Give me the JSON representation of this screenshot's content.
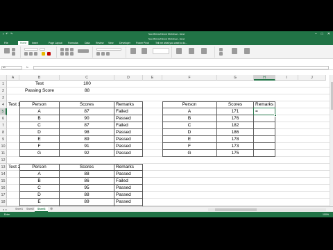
{
  "window": {
    "title_back": "New Microsoft Excel Worksheet - Excel",
    "title_front": "New Microsoft Excel Worksheet - Excel",
    "minimize": "–",
    "maximize": "□",
    "close": "✕"
  },
  "ribbon_tabs": [
    "File",
    "Home",
    "Insert",
    "Page Layout",
    "Formulas",
    "Data",
    "Review",
    "View",
    "Developer",
    "Power Pivot",
    "Tell me what you want to do..."
  ],
  "namebox": "H5",
  "fx_label": "fx",
  "columns": [
    "A",
    "B",
    "C",
    "D",
    "E",
    "F",
    "G",
    "H",
    "I",
    "J"
  ],
  "rows": [
    "1",
    "2",
    "3",
    "4",
    "5",
    "6",
    "7",
    "8",
    "9",
    "10",
    "11",
    "12",
    "13",
    "14",
    "15",
    "16",
    "17",
    "18",
    "19",
    "20"
  ],
  "selected_column": "H",
  "selected_row": "5",
  "cells": {
    "b1": "Test",
    "c1": "100",
    "b2": "Passing Score",
    "c2": "88",
    "a4": "Test 1",
    "a13": "Test 2"
  },
  "test1": {
    "headers": [
      "Person",
      "Scores",
      "Remarks"
    ],
    "rows": [
      [
        "A",
        "87",
        "Failed"
      ],
      [
        "B",
        "90",
        "Passed"
      ],
      [
        "C",
        "87",
        "Failed"
      ],
      [
        "D",
        "98",
        "Passed"
      ],
      [
        "E",
        "89",
        "Passed"
      ],
      [
        "F",
        "91",
        "Passed"
      ],
      [
        "G",
        "92",
        "Passed"
      ]
    ]
  },
  "test2": {
    "headers": [
      "Person",
      "Scores",
      "Remarks"
    ],
    "rows": [
      [
        "A",
        "88",
        "Passed"
      ],
      [
        "B",
        "86",
        "Failed"
      ],
      [
        "C",
        "95",
        "Passed"
      ],
      [
        "D",
        "88",
        "Passed"
      ],
      [
        "E",
        "89",
        "Passed"
      ],
      [
        "F",
        "82",
        "Failed"
      ],
      [
        "G",
        "83",
        "Failed"
      ]
    ]
  },
  "right_table": {
    "headers": [
      "Person",
      "Scores",
      "Remarks"
    ],
    "rows": [
      [
        "A",
        "171",
        "="
      ],
      [
        "B",
        "176",
        ""
      ],
      [
        "C",
        "182",
        ""
      ],
      [
        "D",
        "186",
        ""
      ],
      [
        "E",
        "178",
        ""
      ],
      [
        "F",
        "173",
        ""
      ],
      [
        "G",
        "175",
        ""
      ]
    ]
  },
  "sheet_tabs": [
    "Sheet1",
    "Sheet2",
    "Sheet3"
  ],
  "status": {
    "mode": "Enter",
    "zoom": "100%"
  },
  "colors": {
    "excel_green": "#217346"
  }
}
